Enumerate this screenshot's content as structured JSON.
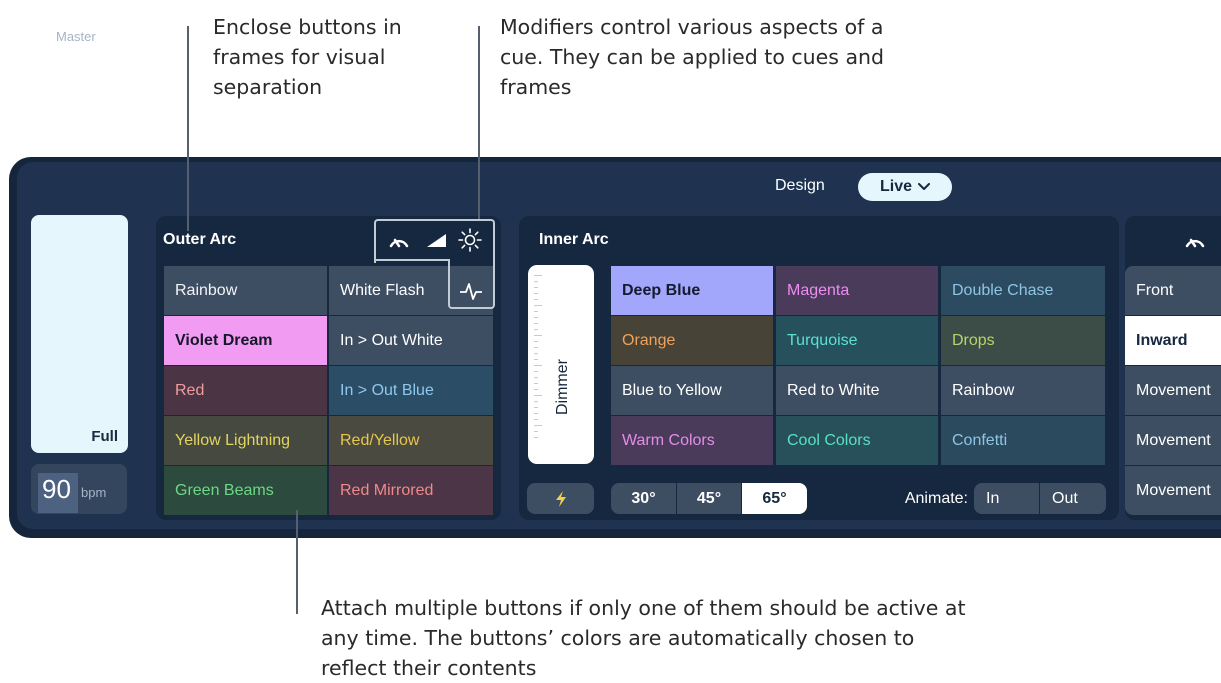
{
  "notes": {
    "frames": [
      "Enclose buttons in",
      "frames for visual",
      "separation"
    ],
    "modifiers": [
      "Modifiers control various aspects of a",
      "cue. They can be applied to cues and",
      "frames"
    ],
    "attach": [
      "Attach multiple buttons if only one of them should be active at",
      "any time. The buttons’ colors are automatically chosen to",
      "reflect their contents"
    ]
  },
  "master": {
    "label": "Master",
    "fader_value": "Full",
    "bpm_value": "90",
    "bpm_unit": "bpm"
  },
  "header": {
    "design_label": "Design",
    "mode_selected": "Live"
  },
  "outer_arc": {
    "title": "Outer Arc",
    "icons": [
      "speed-gauge-icon",
      "ramp-icon",
      "brightness-icon",
      "pulse-icon"
    ],
    "buttons": [
      [
        "Rainbow",
        "White Flash"
      ],
      [
        "Violet Dream",
        "In > Out White"
      ],
      [
        "Red",
        "In > Out Blue"
      ],
      [
        "Yellow Lightning",
        "Red/Yellow"
      ],
      [
        "Green Beams",
        "Red Mirrored"
      ]
    ]
  },
  "inner_arc": {
    "title": "Inner Arc",
    "dimmer_label": "Dimmer",
    "buttons": [
      [
        "Deep Blue",
        "Magenta",
        "Double Chase"
      ],
      [
        "Orange",
        "Turquoise",
        "Drops"
      ],
      [
        "Blue to Yellow",
        "Red to White",
        "Rainbow"
      ],
      [
        "Warm Colors",
        "Cool Colors",
        "Confetti"
      ]
    ],
    "flash_icon": "lightning-icon",
    "angles": [
      "30°",
      "45°",
      "65°"
    ],
    "angle_selected": "65°",
    "animate_label": "Animate:",
    "animate_options": [
      "In",
      "Out"
    ]
  },
  "third_frame": {
    "items": [
      "Front",
      "Inward",
      "Movement",
      "Movement",
      "Movement"
    ],
    "selected": "Inward"
  },
  "colors": {
    "violet_dream": "#f29bf3",
    "deep_blue": "#a3a7fb",
    "panel": "#1f3350",
    "frame": "#16283f",
    "outline": "#c2ccd6"
  }
}
